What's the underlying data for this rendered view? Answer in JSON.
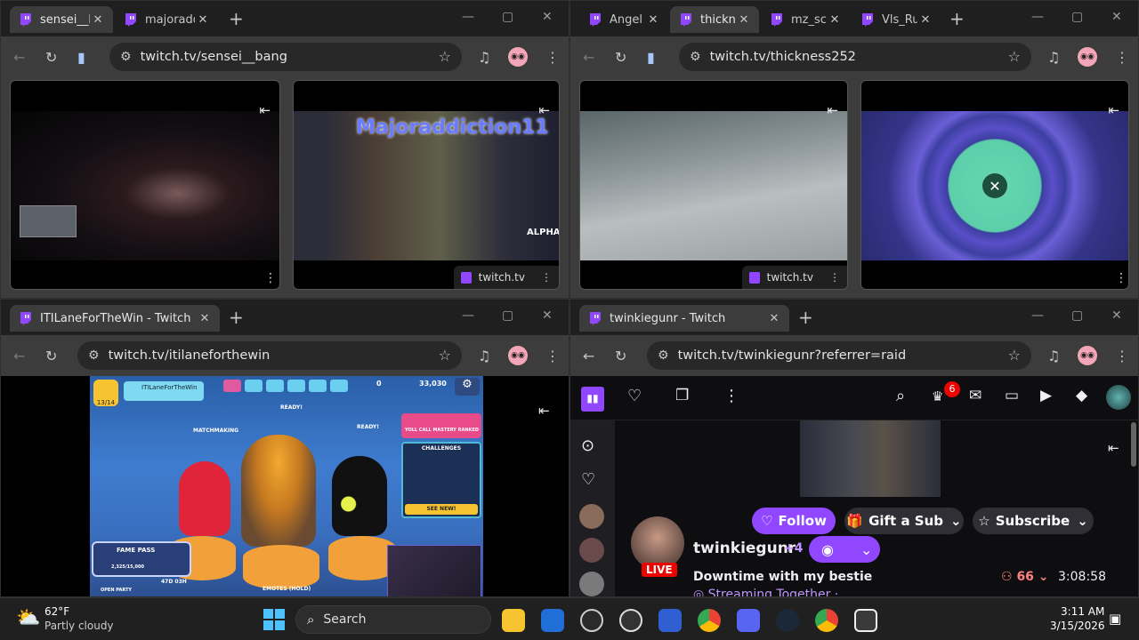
{
  "windows": {
    "top_left": {
      "tabs": [
        {
          "label": "sensei__b"
        },
        {
          "label": "majoradd"
        }
      ],
      "url": "twitch.tv/sensei__bang",
      "pip_bar_label": "twitch.tv"
    },
    "top_right": {
      "tabs": [
        {
          "label": "Angel"
        },
        {
          "label": "thickn"
        },
        {
          "label": "mz_sc"
        },
        {
          "label": "Vls_Ru"
        }
      ],
      "url": "twitch.tv/thickness252",
      "pip_bar_label": "twitch.tv"
    },
    "bottom_left": {
      "tabs": [
        {
          "label": "ITILaneForTheWin - Twitch"
        }
      ],
      "url": "twitch.tv/itilaneforthewin",
      "game": {
        "player_name": "ITILaneForTheWin",
        "level": "13/14",
        "coins": "0",
        "gems": "33,030",
        "matchmaking": "MATCHMAKING",
        "ready": "READY!",
        "fame_pass": "FAME PASS",
        "fame_progress": "2,325/15,000",
        "fame_time": "47D 03H",
        "challenges": "CHALLENGES",
        "open_party": "OPEN PARTY",
        "emotes": "EMOTES (HOLD)",
        "mastery": "YOLL CALL MASTERY RANKED",
        "see_new": "SEE NEW!"
      }
    },
    "bottom_right": {
      "tabs": [
        {
          "label": "twinkiegunr - Twitch"
        }
      ],
      "url": "twitch.tv/twinkiegunr?referrer=raid",
      "twitch": {
        "notif_count": "6",
        "follow_label": "Follow",
        "gift_label": "Gift a Sub",
        "subscribe_label": "Subscribe",
        "channel_name": "twinkiegunr",
        "plus_count": "+4",
        "live_label": "LIVE",
        "stream_title": "Downtime with my bestie",
        "streaming_together": "Streaming Together ·",
        "viewers": "66",
        "uptime": "3:08:58"
      }
    }
  },
  "overlay_texts": {
    "majoraddiction": "Majoraddiction11",
    "alpha": "ALPHA"
  },
  "taskbar": {
    "temp": "62°F",
    "weather": "Partly cloudy",
    "search_label": "Search",
    "time": "3:11 AM",
    "date": "3/15/2026"
  },
  "colors": {
    "twitch_purple": "#9146ff",
    "chrome_dark": "#1f1f1f",
    "toolbar": "#3c3c3c"
  }
}
